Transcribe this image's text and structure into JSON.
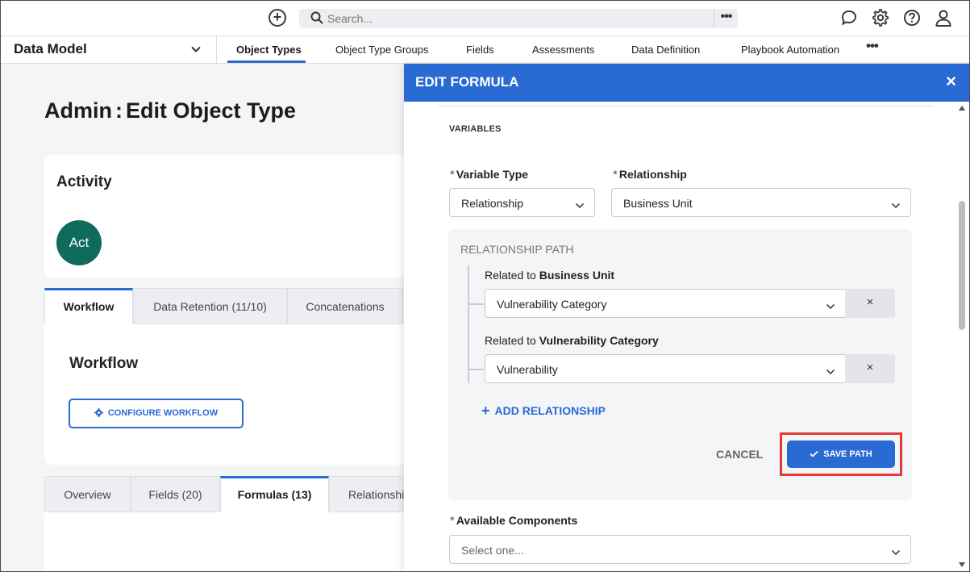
{
  "topbar": {
    "search_placeholder": "Search...",
    "search_more": "•••",
    "icons": [
      "add-circle-icon",
      "search-icon",
      "chat-icon",
      "gear-icon",
      "help-icon",
      "user-icon"
    ]
  },
  "nav": {
    "section_title": "Data Model",
    "items": [
      "Object Types",
      "Object Type Groups",
      "Fields",
      "Assessments",
      "Data Definition",
      "Playbook Automation"
    ],
    "active_index": 0,
    "more": "•••"
  },
  "page": {
    "title_prefix": "Admin",
    "title_sep": ":",
    "title_main": "Edit Object Type",
    "activity_title": "Activity",
    "avatar_text": "Act",
    "tabs_top": [
      "Workflow",
      "Data Retention (11/10)",
      "Concatenations"
    ],
    "workflow_title": "Workflow",
    "configure_workflow": "CONFIGURE WORKFLOW",
    "tabs_bottom": [
      "Overview",
      "Fields (20)",
      "Formulas (13)",
      "Relationshi"
    ]
  },
  "modal": {
    "title": "EDIT FORMULA",
    "close": "×",
    "variables_label": "VARIABLES",
    "variable_type_label": "Variable Type",
    "variable_type_value": "Relationship",
    "relationship_label": "Relationship",
    "relationship_value": "Business Unit",
    "required_mark": "*",
    "relationship_path_title": "RELATIONSHIP PATH",
    "path": [
      {
        "prefix": "Related to",
        "target": "Business Unit",
        "value": "Vulnerability Category"
      },
      {
        "prefix": "Related to",
        "target": "Vulnerability Category",
        "value": "Vulnerability"
      }
    ],
    "remove_glyph": "×",
    "add_relationship": "ADD RELATIONSHIP",
    "add_glyph": "+",
    "cancel": "CANCEL",
    "save_path": "SAVE PATH",
    "available_components_label": "Available Components",
    "available_components_placeholder": "Select one...",
    "accent_color": "#2a6ad3",
    "highlight_color": "#e53935"
  }
}
